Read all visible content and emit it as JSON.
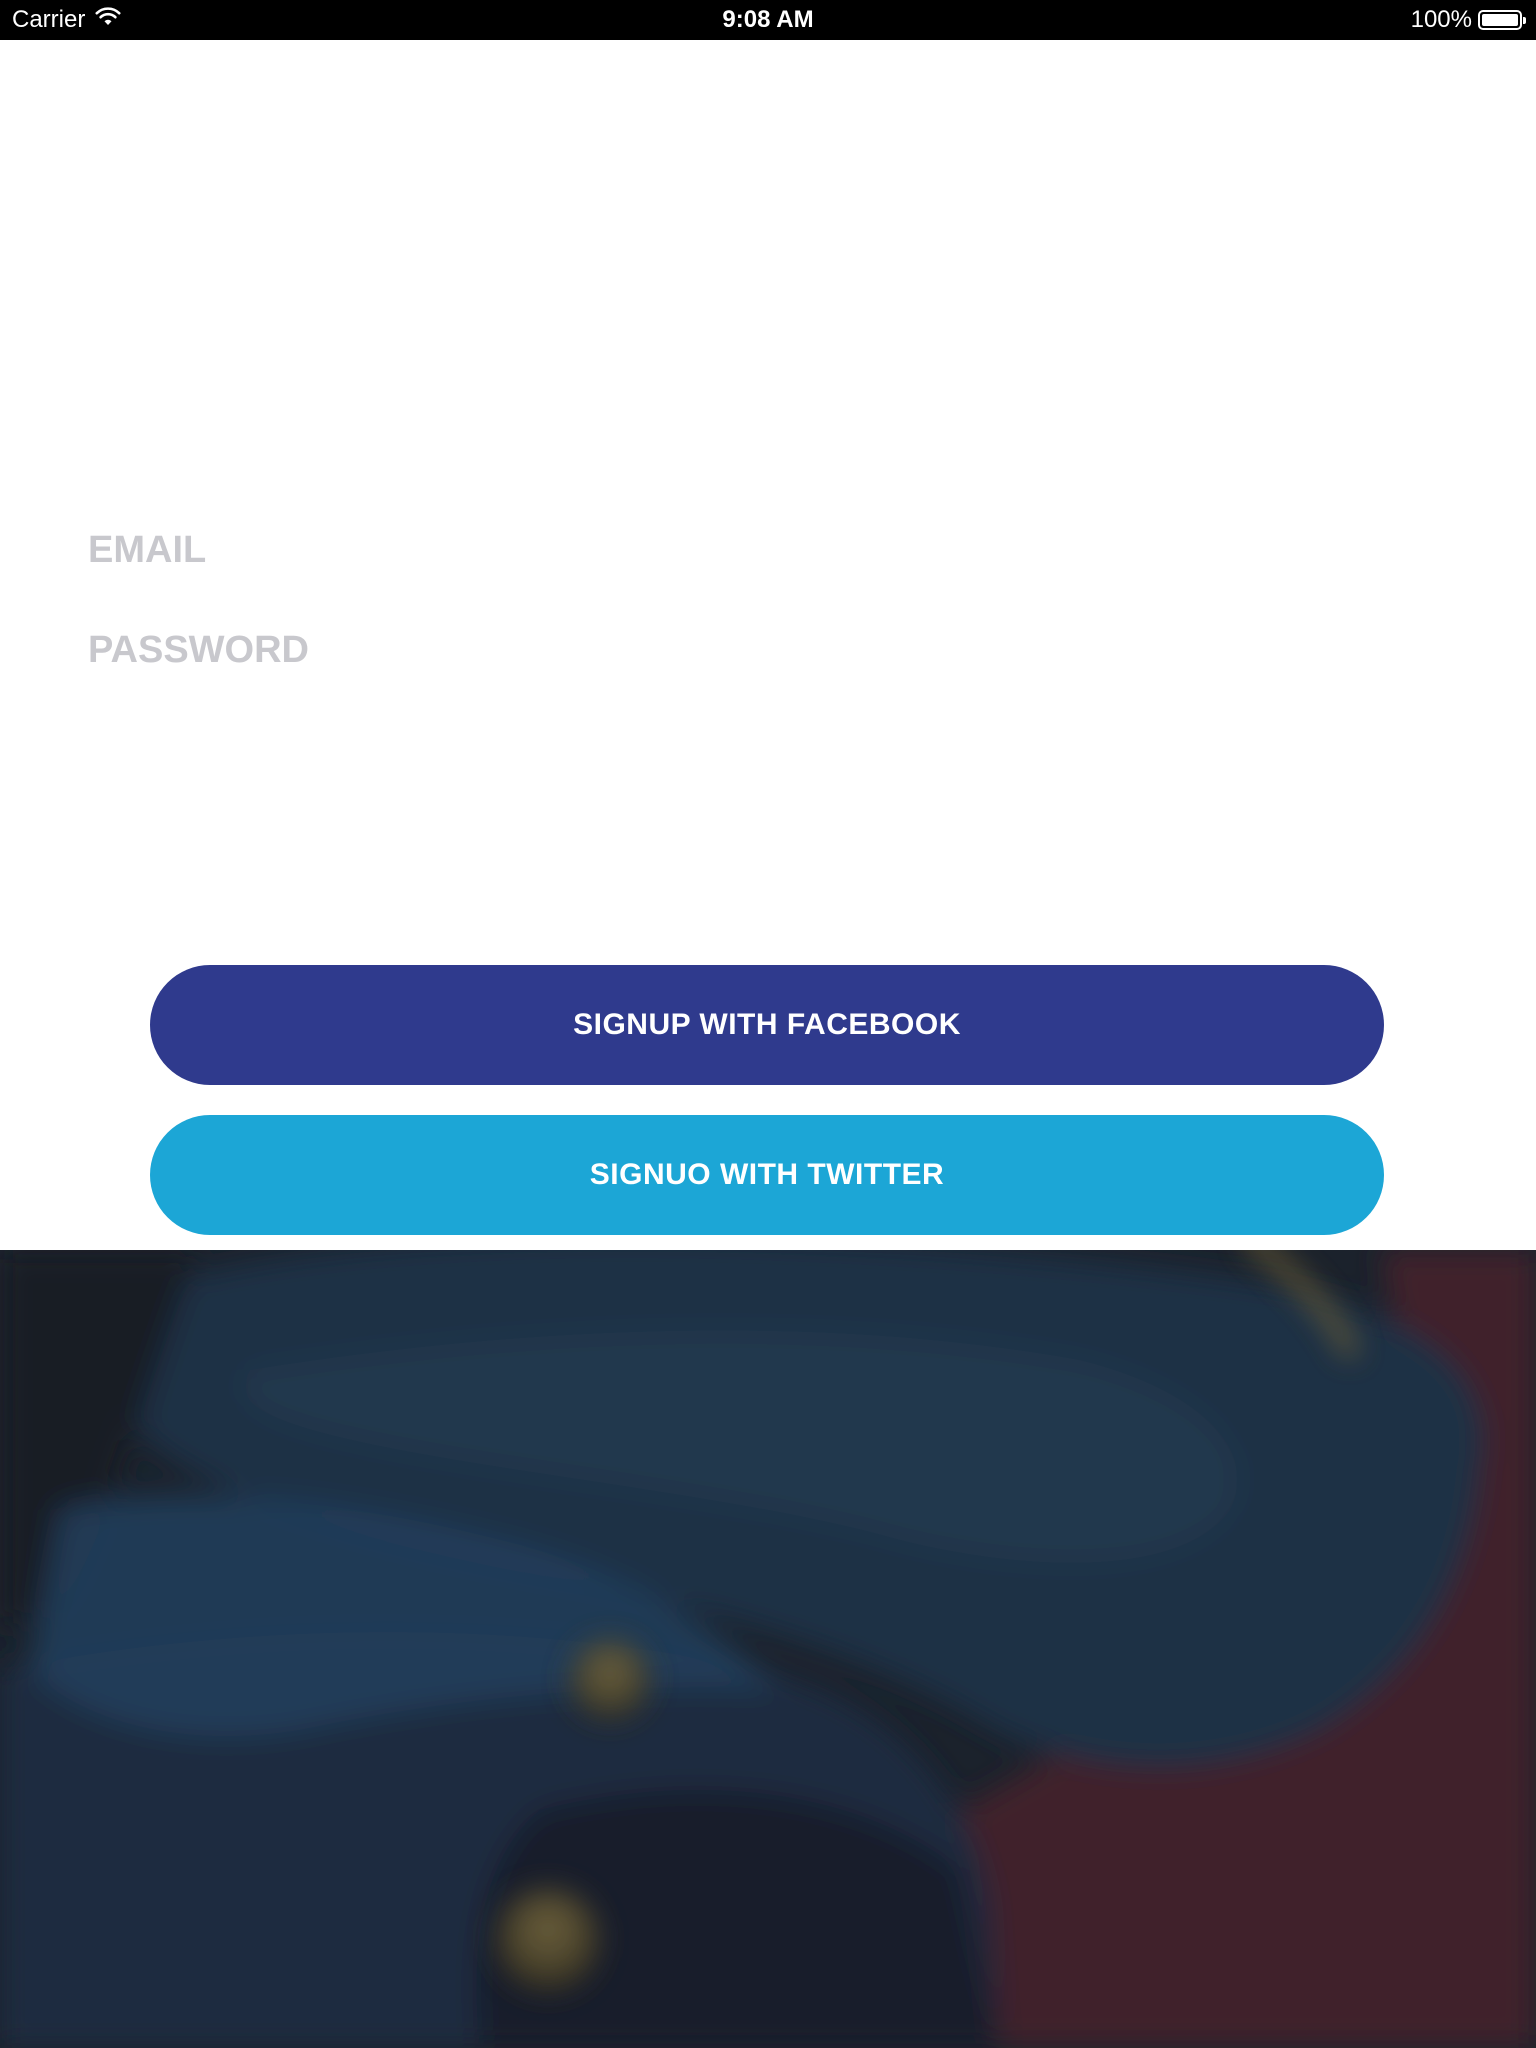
{
  "status_bar": {
    "carrier": "Carrier",
    "time": "9:08 AM",
    "battery": "100%",
    "battery_level": 1.0
  },
  "form": {
    "email_placeholder": "EMAIL",
    "password_placeholder": "PASSWORD"
  },
  "buttons": {
    "facebook_label": "SIGNUP WITH FACEBOOK",
    "twitter_label": "SIGNUO WITH TWITTER"
  },
  "colors": {
    "facebook": "#2f3a8d",
    "twitter": "#1ca6d6",
    "placeholder": "#c8c8cd"
  },
  "icons": {
    "wifi": "wifi-icon",
    "battery": "battery-icon"
  }
}
